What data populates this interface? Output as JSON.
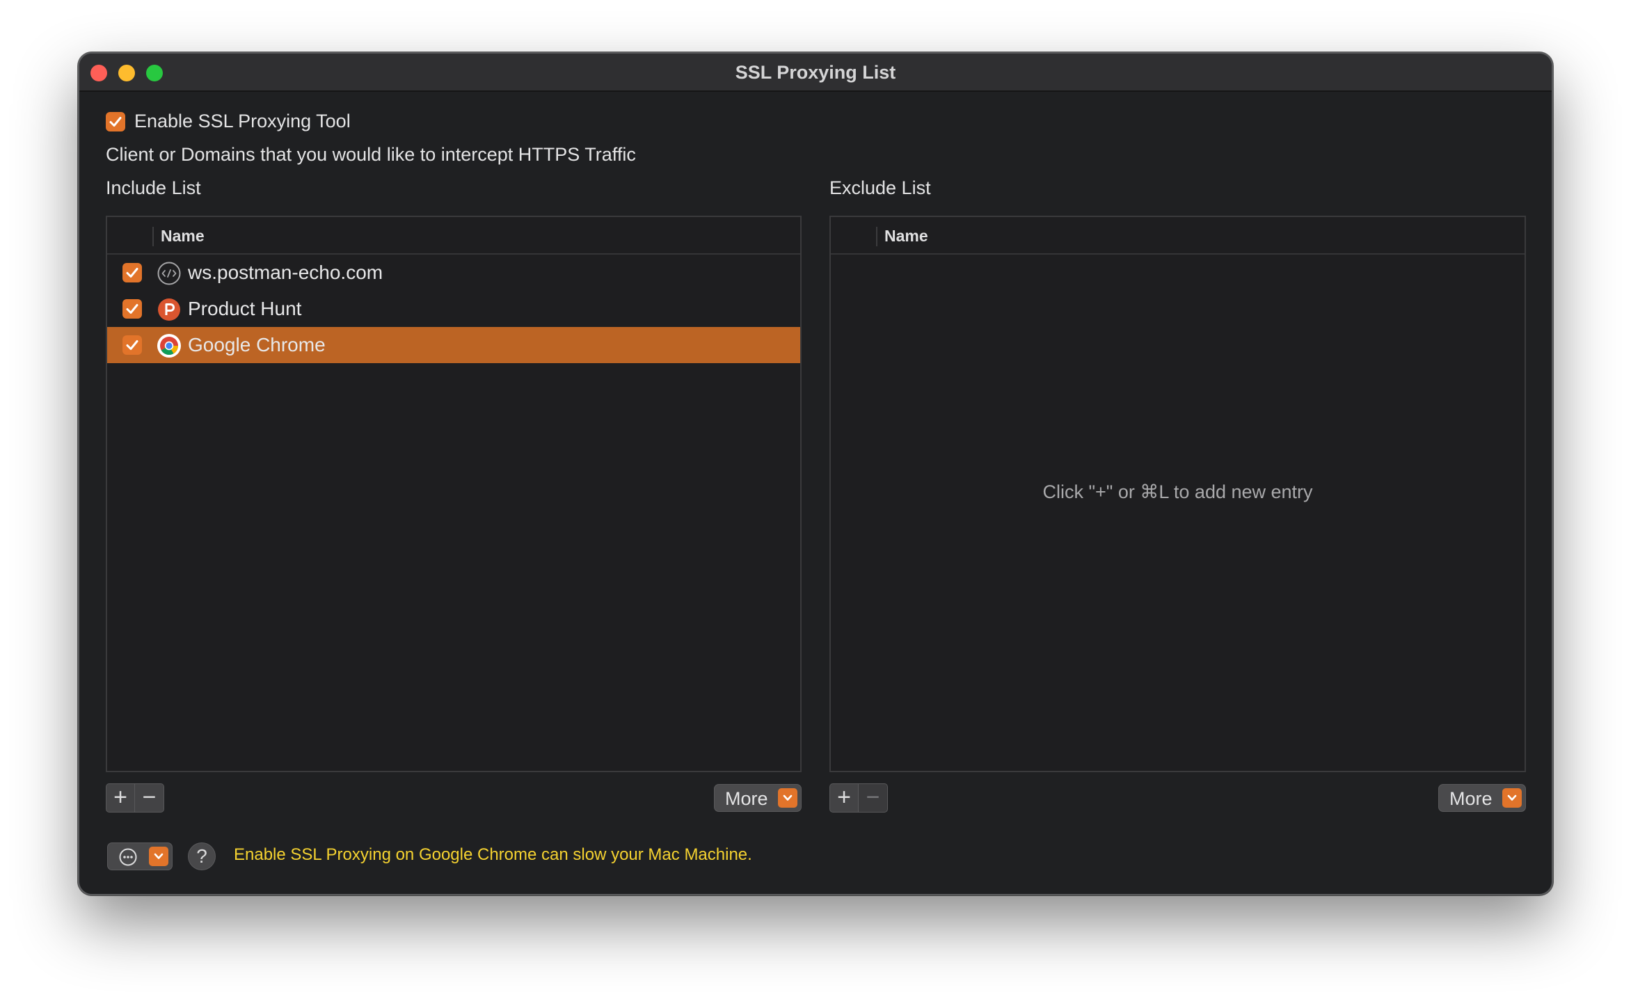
{
  "window": {
    "title": "SSL Proxying List"
  },
  "enable": {
    "label": "Enable SSL Proxying Tool",
    "checked": true
  },
  "description": "Client or Domains that you would like to intercept HTTPS Traffic",
  "include": {
    "heading": "Include List",
    "column_name": "Name",
    "rows": [
      {
        "label": "ws.postman-echo.com",
        "icon": "code-globe-icon",
        "checked": true,
        "selected": false
      },
      {
        "label": "Product Hunt",
        "icon": "product-hunt-icon",
        "checked": true,
        "selected": false
      },
      {
        "label": "Google Chrome",
        "icon": "chrome-icon",
        "checked": true,
        "selected": true
      }
    ],
    "add_label": "+",
    "remove_label": "−",
    "more_label": "More"
  },
  "exclude": {
    "heading": "Exclude List",
    "column_name": "Name",
    "empty_message": "Click \"+\" or ⌘L to add new entry",
    "add_label": "+",
    "remove_label": "−",
    "more_label": "More"
  },
  "footer": {
    "help_label": "?",
    "warning": "Enable SSL Proxying on Google Chrome can slow your Mac Machine."
  },
  "colors": {
    "accent": "#e2742a",
    "selection": "#bc6424",
    "warning": "#f5d230",
    "window_bg": "#1f2022"
  }
}
